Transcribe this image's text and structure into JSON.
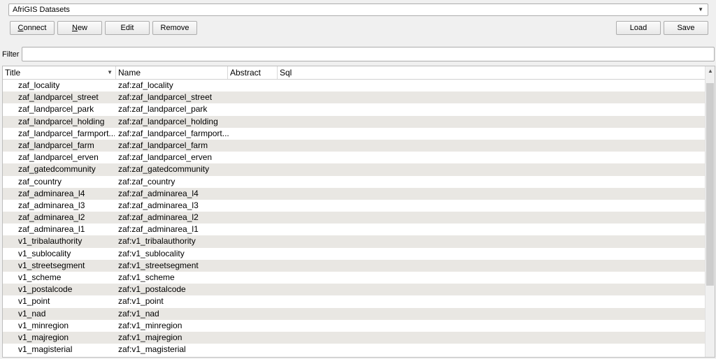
{
  "connection": {
    "selected": "AfriGIS Datasets",
    "arrow": "▼"
  },
  "buttons": {
    "connect": {
      "mnemonic": "C",
      "rest": "onnect"
    },
    "new": {
      "mnemonic": "N",
      "rest": "ew"
    },
    "edit": "Edit",
    "remove": "Remove",
    "load": "Load",
    "save": "Save"
  },
  "filter": {
    "label": "Filter",
    "value": ""
  },
  "table": {
    "columns": [
      "Title",
      "Name",
      "Abstract",
      "Sql"
    ],
    "sort_indicator": "▼",
    "rows": [
      {
        "title": "zaf_locality",
        "name": "zaf:zaf_locality"
      },
      {
        "title": "zaf_landparcel_street",
        "name": "zaf:zaf_landparcel_street"
      },
      {
        "title": "zaf_landparcel_park",
        "name": "zaf:zaf_landparcel_park"
      },
      {
        "title": "zaf_landparcel_holding",
        "name": "zaf:zaf_landparcel_holding"
      },
      {
        "title": "zaf_landparcel_farmport...",
        "name": "zaf:zaf_landparcel_farmport..."
      },
      {
        "title": "zaf_landparcel_farm",
        "name": "zaf:zaf_landparcel_farm"
      },
      {
        "title": "zaf_landparcel_erven",
        "name": "zaf:zaf_landparcel_erven"
      },
      {
        "title": "zaf_gatedcommunity",
        "name": "zaf:zaf_gatedcommunity"
      },
      {
        "title": "zaf_country",
        "name": "zaf:zaf_country"
      },
      {
        "title": "zaf_adminarea_l4",
        "name": "zaf:zaf_adminarea_l4"
      },
      {
        "title": "zaf_adminarea_l3",
        "name": "zaf:zaf_adminarea_l3"
      },
      {
        "title": "zaf_adminarea_l2",
        "name": "zaf:zaf_adminarea_l2"
      },
      {
        "title": "zaf_adminarea_l1",
        "name": "zaf:zaf_adminarea_l1"
      },
      {
        "title": "v1_tribalauthority",
        "name": "zaf:v1_tribalauthority"
      },
      {
        "title": "v1_sublocality",
        "name": "zaf:v1_sublocality"
      },
      {
        "title": "v1_streetsegment",
        "name": "zaf:v1_streetsegment"
      },
      {
        "title": "v1_scheme",
        "name": "zaf:v1_scheme"
      },
      {
        "title": "v1_postalcode",
        "name": "zaf:v1_postalcode"
      },
      {
        "title": "v1_point",
        "name": "zaf:v1_point"
      },
      {
        "title": "v1_nad",
        "name": "zaf:v1_nad"
      },
      {
        "title": "v1_minregion",
        "name": "zaf:v1_minregion"
      },
      {
        "title": "v1_majregion",
        "name": "zaf:v1_majregion"
      },
      {
        "title": "v1_magisterial",
        "name": "zaf:v1_magisterial"
      }
    ]
  },
  "scrollbar": {
    "up_arrow": "▲"
  }
}
